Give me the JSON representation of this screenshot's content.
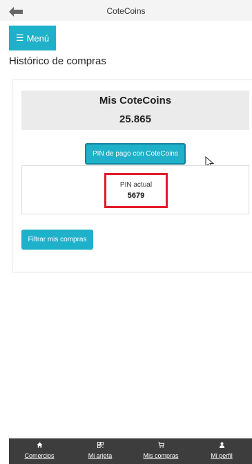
{
  "header": {
    "title": "CoteCoins",
    "back_icon": "arrow-left-icon"
  },
  "menu": {
    "label": "Menú",
    "icon": "hamburger-icon"
  },
  "page": {
    "title": "Histórico de compras"
  },
  "balance": {
    "title": "Mis CoteCoins",
    "value": "25.865"
  },
  "pin": {
    "button_label": "PIN de pago con CoteCoins",
    "label": "PIN actual",
    "value": "5679",
    "highlight_color": "#e21b2c"
  },
  "filter": {
    "button_label": "Filtrar mis compras"
  },
  "bottom_nav": [
    {
      "label": "Comercios",
      "icon": "home-icon"
    },
    {
      "label": "Mi arjeta",
      "icon": "qr-code-icon"
    },
    {
      "label": "Mis compras",
      "icon": "cart-icon"
    },
    {
      "label": "Mi perfil",
      "icon": "user-icon"
    }
  ],
  "colors": {
    "accent": "#1fb1c9",
    "nav_background": "#3d3d3d",
    "balance_background": "#ebebeb"
  }
}
